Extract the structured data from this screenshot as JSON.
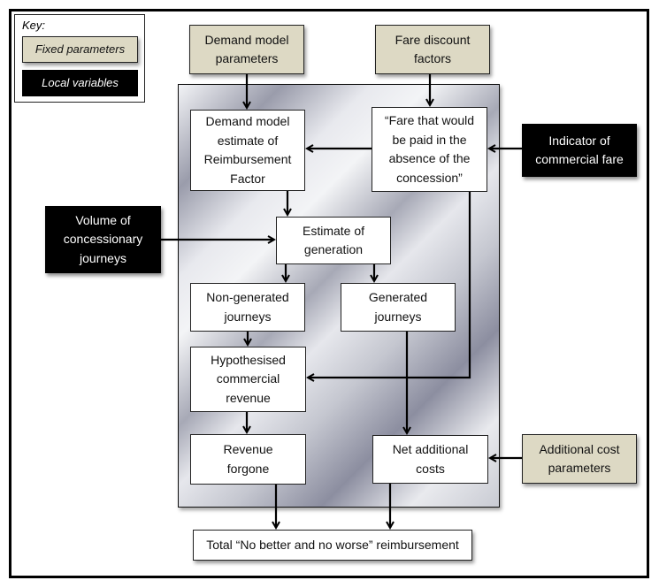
{
  "key": {
    "title": "Key:",
    "fixed_label": "Fixed parameters",
    "local_label": "Local variables",
    "colors": {
      "fixed": "#ddd9c4",
      "local": "#000000",
      "internal": "#ffffff"
    }
  },
  "nodes": {
    "demand_model_parameters": "Demand model\nparameters",
    "fare_discount_factors": "Fare discount\nfactors",
    "demand_model_estimate": "Demand model\nestimate of\nReimbursement\nFactor",
    "fare_absence": "“Fare that would\nbe paid in the\nabsence of the\nconcession”",
    "indicator_commercial_fare": "Indicator of\ncommercial fare",
    "volume_concessionary": "Volume of\nconcessionary\njourneys",
    "estimate_generation": "Estimate of\ngeneration",
    "non_generated": "Non-generated\njourneys",
    "generated": "Generated\njourneys",
    "hypothesised_revenue": "Hypothesised\ncommercial\nrevenue",
    "revenue_forgone": "Revenue\nforgone",
    "net_additional_costs": "Net additional\ncosts",
    "additional_cost_parameters": "Additional cost\nparameters",
    "total_reimbursement": "Total “No better and no worse” reimbursement"
  },
  "edges": [
    [
      "demand_model_parameters",
      "demand_model_estimate"
    ],
    [
      "fare_discount_factors",
      "fare_absence"
    ],
    [
      "fare_absence",
      "demand_model_estimate"
    ],
    [
      "indicator_commercial_fare",
      "fare_absence"
    ],
    [
      "demand_model_estimate",
      "estimate_generation"
    ],
    [
      "volume_concessionary",
      "estimate_generation"
    ],
    [
      "estimate_generation",
      "non_generated"
    ],
    [
      "estimate_generation",
      "generated"
    ],
    [
      "non_generated",
      "hypothesised_revenue"
    ],
    [
      "fare_absence",
      "hypothesised_revenue"
    ],
    [
      "generated",
      "net_additional_costs"
    ],
    [
      "hypothesised_revenue",
      "revenue_forgone"
    ],
    [
      "additional_cost_parameters",
      "net_additional_costs"
    ],
    [
      "revenue_forgone",
      "total_reimbursement"
    ],
    [
      "net_additional_costs",
      "total_reimbursement"
    ]
  ]
}
